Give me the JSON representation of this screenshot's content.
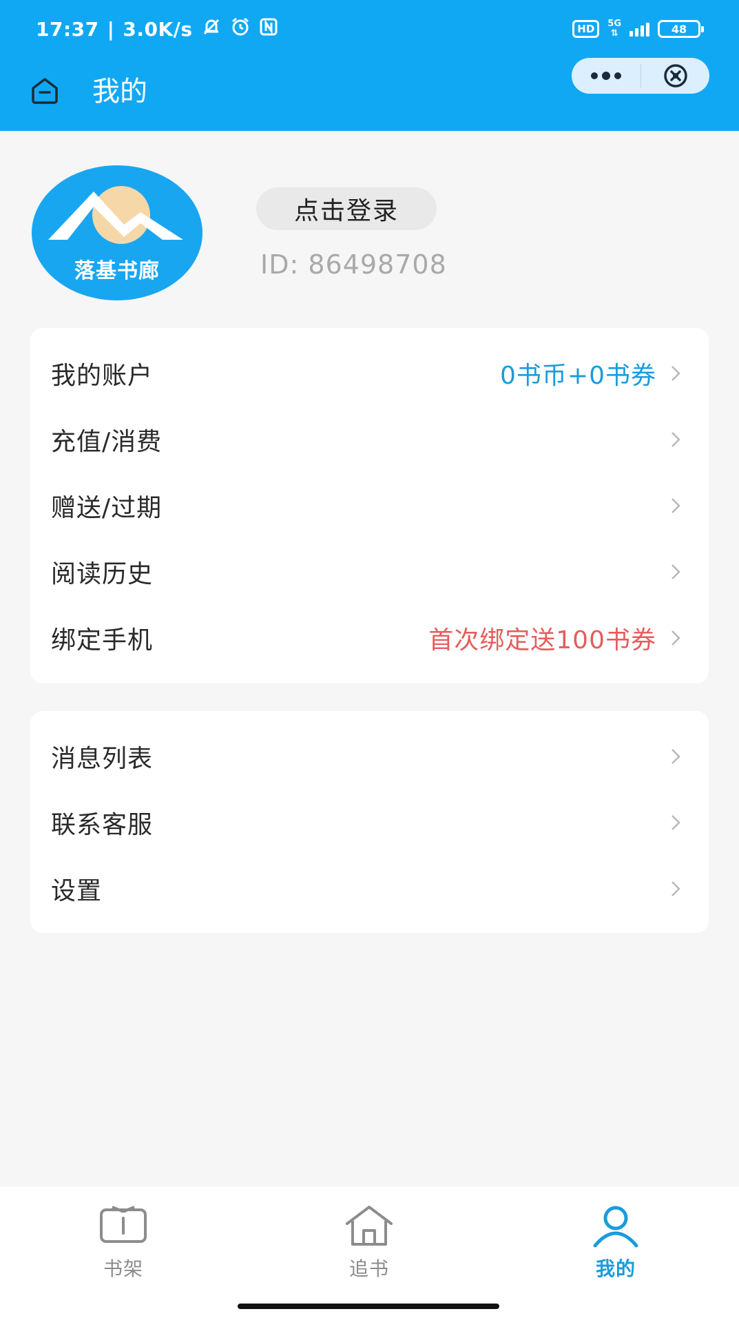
{
  "status_bar": {
    "time": "17:37",
    "net_speed": "3.0K/s",
    "hd": "HD",
    "network": "5G",
    "battery": "48"
  },
  "nav": {
    "title": "我的"
  },
  "profile": {
    "logo_text": "落基书廊",
    "login_label": "点击登录",
    "user_id": "ID: 86498708"
  },
  "menu_group_1": [
    {
      "label": "我的账户",
      "value": "0书币+0书券"
    },
    {
      "label": "充值/消费",
      "value": ""
    },
    {
      "label": "赠送/过期",
      "value": ""
    },
    {
      "label": "阅读历史",
      "value": ""
    },
    {
      "label": "绑定手机",
      "value": "首次绑定送100书券"
    }
  ],
  "menu_group_2": [
    {
      "label": "消息列表"
    },
    {
      "label": "联系客服"
    },
    {
      "label": "设置"
    }
  ],
  "tabs": [
    {
      "label": "书架",
      "icon": "bookshelf-icon",
      "active": false
    },
    {
      "label": "追书",
      "icon": "house-icon",
      "active": false
    },
    {
      "label": "我的",
      "icon": "person-icon",
      "active": true
    }
  ],
  "colors": {
    "brand": "#11a8f3",
    "accent_blue": "#1a9bdc",
    "accent_red": "#e45d5d"
  }
}
